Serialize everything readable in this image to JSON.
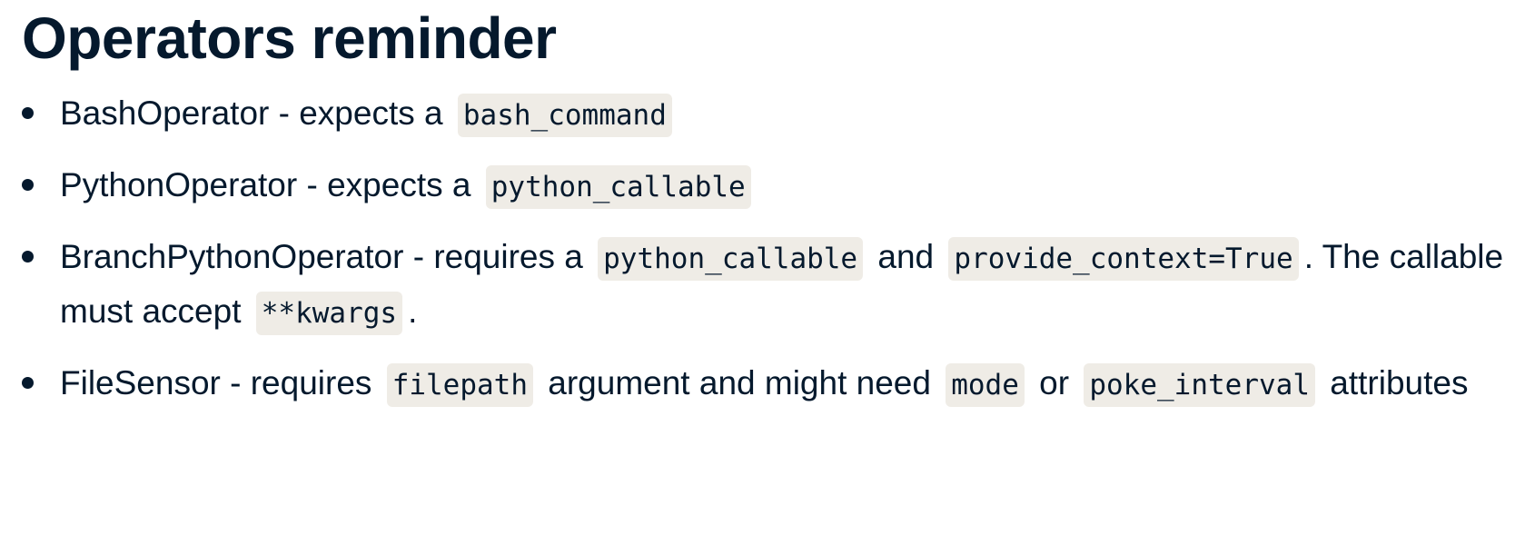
{
  "title": "Operators reminder",
  "items": [
    {
      "t1": "BashOperator - expects a",
      "c1": "bash_command"
    },
    {
      "t1": "PythonOperator - expects a",
      "c1": "python_callable"
    },
    {
      "t1": "BranchPythonOperator - requires a",
      "c1": "python_callable",
      "t2": "and",
      "c2": "provide_context=True",
      "t3": ". The callable must accept",
      "c3": "**kwargs",
      "t4": "."
    },
    {
      "t1": "FileSensor - requires",
      "c1": "filepath",
      "t2": "argument and might need",
      "c2": "mode",
      "t3": "or",
      "c3": "poke_interval",
      "t4": "attributes"
    }
  ]
}
